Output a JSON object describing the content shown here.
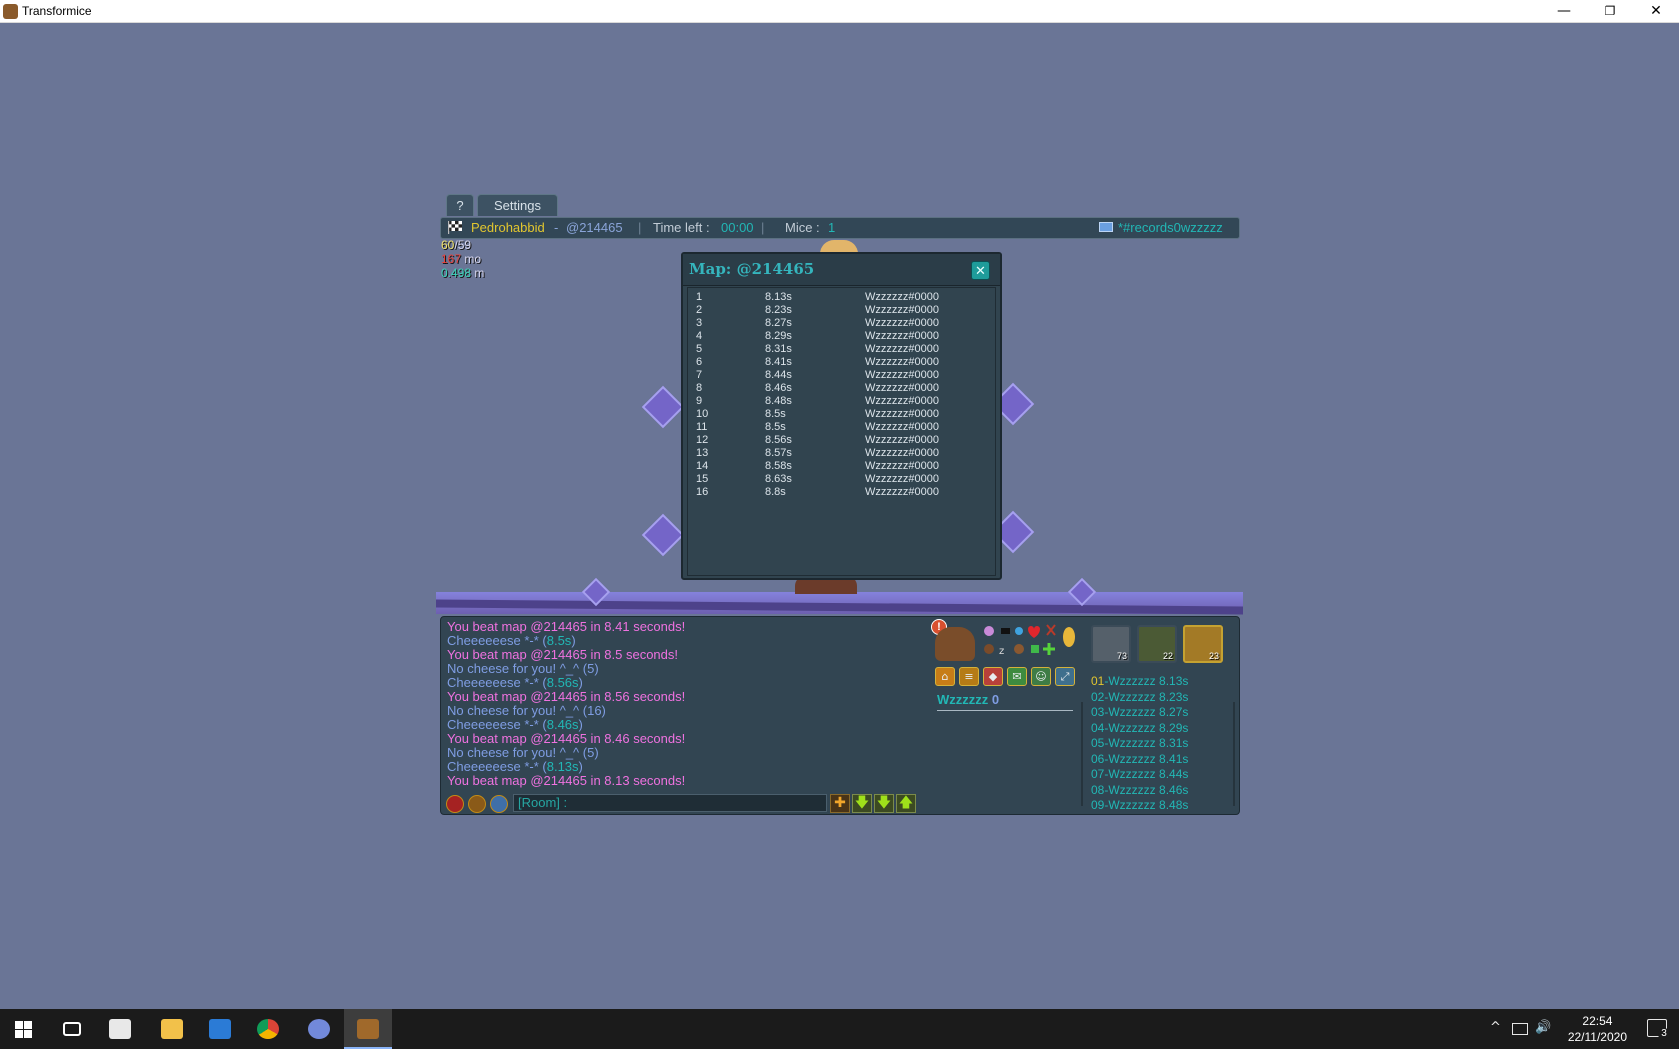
{
  "window": {
    "title": "Transformice",
    "minimize": "—",
    "restore": "❐",
    "close": "✕"
  },
  "tabs": {
    "help": "?",
    "settings": "Settings"
  },
  "infobar": {
    "player": "Pedrohabbid",
    "map_sep": " - ",
    "map_code": "@214465",
    "divider": "|",
    "time_label": "Time left : ",
    "time_value": "00:00",
    "mice_label": "Mice : ",
    "mice_value": "1",
    "room": "*#records0wzzzzz"
  },
  "stats": {
    "fps_a": "60",
    "fps_b": "/59",
    "ping_value": "167",
    "ping_unit": " mo",
    "speed_value": "0.498",
    "speed_unit": " m"
  },
  "map_window": {
    "title": "Map: @214465",
    "close": "✕",
    "records": [
      {
        "rank": "1",
        "time": "8.13s",
        "player": "Wzzzzzz#0000"
      },
      {
        "rank": "2",
        "time": "8.23s",
        "player": "Wzzzzzz#0000"
      },
      {
        "rank": "3",
        "time": "8.27s",
        "player": "Wzzzzzz#0000"
      },
      {
        "rank": "4",
        "time": "8.29s",
        "player": "Wzzzzzz#0000"
      },
      {
        "rank": "5",
        "time": "8.31s",
        "player": "Wzzzzzz#0000"
      },
      {
        "rank": "6",
        "time": "8.41s",
        "player": "Wzzzzzz#0000"
      },
      {
        "rank": "7",
        "time": "8.44s",
        "player": "Wzzzzzz#0000"
      },
      {
        "rank": "8",
        "time": "8.46s",
        "player": "Wzzzzzz#0000"
      },
      {
        "rank": "9",
        "time": "8.48s",
        "player": "Wzzzzzz#0000"
      },
      {
        "rank": "10",
        "time": "8.5s",
        "player": "Wzzzzzz#0000"
      },
      {
        "rank": "11",
        "time": "8.5s",
        "player": "Wzzzzzz#0000"
      },
      {
        "rank": "12",
        "time": "8.56s",
        "player": "Wzzzzzz#0000"
      },
      {
        "rank": "13",
        "time": "8.57s",
        "player": "Wzzzzzz#0000"
      },
      {
        "rank": "14",
        "time": "8.58s",
        "player": "Wzzzzzz#0000"
      },
      {
        "rank": "15",
        "time": "8.63s",
        "player": "Wzzzzzz#0000"
      },
      {
        "rank": "16",
        "time": "8.8s",
        "player": "Wzzzzzz#0000"
      }
    ]
  },
  "chat": {
    "lines": [
      {
        "kind": "beat",
        "text": "You beat map @214465 in 8.41 seconds!"
      },
      {
        "kind": "cheese",
        "text": "Cheeeeeese *-* (",
        "value": "8.5s",
        "end": ")"
      },
      {
        "kind": "beat",
        "text": "You beat map @214465 in 8.5 seconds!"
      },
      {
        "kind": "nocheese",
        "text": "No cheese for you! ^_^ (5)"
      },
      {
        "kind": "cheese",
        "text": "Cheeeeeese *-* (",
        "value": "8.56s",
        "end": ")"
      },
      {
        "kind": "beat",
        "text": "You beat map @214465 in 8.56 seconds!"
      },
      {
        "kind": "nocheese",
        "text": "No cheese for you! ^_^ (16)"
      },
      {
        "kind": "cheese",
        "text": "Cheeeeeese *-* (",
        "value": "8.46s",
        "end": ")"
      },
      {
        "kind": "beat",
        "text": "You beat map @214465 in 8.46 seconds!"
      },
      {
        "kind": "nocheese",
        "text": "No cheese for you! ^_^ (5)"
      },
      {
        "kind": "cheese",
        "text": "Cheeeeeese *-* (",
        "value": "8.13s",
        "end": ")"
      },
      {
        "kind": "beat",
        "text": "You beat map @214465 in 8.13 seconds!"
      }
    ],
    "input_placeholder": "[Room] :",
    "buttons": {
      "add": "✚",
      "down1": "🡇",
      "down2": "🡇",
      "up": "🡅"
    }
  },
  "player_panel": {
    "name": "Wzzzzzz",
    "score": "0"
  },
  "avatars": [
    {
      "count": "73"
    },
    {
      "count": "22"
    },
    {
      "count": "23"
    }
  ],
  "ranking": [
    {
      "pos": "01",
      "rest": "-Wzzzzzz 8.13s"
    },
    {
      "pos": "02",
      "rest": "-Wzzzzzz 8.23s"
    },
    {
      "pos": "03",
      "rest": "-Wzzzzzz 8.27s"
    },
    {
      "pos": "04",
      "rest": "-Wzzzzzz 8.29s"
    },
    {
      "pos": "05",
      "rest": "-Wzzzzzz 8.31s"
    },
    {
      "pos": "06",
      "rest": "-Wzzzzzz 8.41s"
    },
    {
      "pos": "07",
      "rest": "-Wzzzzzz 8.44s"
    },
    {
      "pos": "08",
      "rest": "-Wzzzzzz 8.46s"
    },
    {
      "pos": "09",
      "rest": "-Wzzzzzz 8.48s"
    }
  ],
  "taskbar": {
    "time": "22:54",
    "date": "22/11/2020",
    "notifications": "3"
  },
  "colors": {
    "background": "#6a7596",
    "panel": "#324552",
    "accent_cyan": "#22b7b5",
    "accent_pink": "#ef72e0",
    "accent_yellow": "#e2c62f"
  }
}
